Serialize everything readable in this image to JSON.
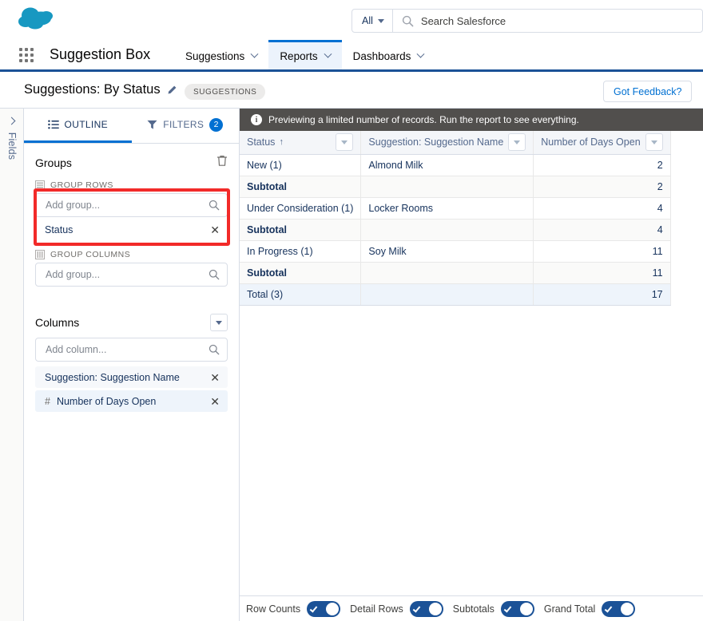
{
  "global_header": {
    "logo_icon": "salesforce-cloud-logo",
    "search": {
      "scope_label": "All",
      "placeholder": "Search Salesforce",
      "icon": "search-icon"
    }
  },
  "app_nav": {
    "launcher_icon": "app-launcher-waffle-icon",
    "app_name": "Suggestion Box",
    "tabs": [
      {
        "label": "Suggestions",
        "active": false,
        "icon": "chevron-down-icon"
      },
      {
        "label": "Reports",
        "active": true,
        "icon": "chevron-down-icon"
      },
      {
        "label": "Dashboards",
        "active": false,
        "icon": "chevron-down-icon"
      }
    ]
  },
  "page_header": {
    "title": "Suggestions: By Status",
    "edit_icon": "pencil-icon",
    "tag": "SUGGESTIONS",
    "feedback_button": "Got Feedback?"
  },
  "fields_rail": {
    "label": "Fields",
    "expand_icon": "chevron-right-icon"
  },
  "outline_panel": {
    "tabs": [
      {
        "label": "OUTLINE",
        "icon": "list-outline-icon",
        "active": true,
        "badge": null
      },
      {
        "label": "FILTERS",
        "icon": "filter-funnel-icon",
        "active": false,
        "badge": "2"
      }
    ],
    "groups": {
      "title": "Groups",
      "delete_icon": "trash-icon",
      "group_rows": {
        "heading": "GROUP ROWS",
        "icon": "group-rows-icon",
        "add_placeholder": "Add group...",
        "search_icon": "search-icon",
        "items": [
          {
            "label": "Status",
            "remove_icon": "close-icon"
          }
        ]
      },
      "group_columns": {
        "heading": "GROUP COLUMNS",
        "icon": "group-columns-icon",
        "add_placeholder": "Add group...",
        "search_icon": "search-icon",
        "items": []
      }
    },
    "columns": {
      "title": "Columns",
      "menu_icon": "chevron-down-icon",
      "add_placeholder": "Add column...",
      "search_icon": "search-icon",
      "items": [
        {
          "label": "Suggestion: Suggestion Name",
          "type_marker": "",
          "remove_icon": "close-icon"
        },
        {
          "label": "Number of Days Open",
          "type_marker": "#",
          "remove_icon": "close-icon"
        }
      ]
    }
  },
  "preview": {
    "notice": {
      "icon": "info-icon",
      "text": "Previewing a limited number of records. Run the report to see everything."
    },
    "columns": [
      {
        "label": "Status",
        "sort_icon": "sort-ascending-arrow",
        "menu_icon": "dropdown-triangle-icon",
        "align": "left"
      },
      {
        "label": "Suggestion: Suggestion Name",
        "sort_icon": "",
        "menu_icon": "dropdown-triangle-icon",
        "align": "left"
      },
      {
        "label": "Number of Days Open",
        "sort_icon": "",
        "menu_icon": "dropdown-triangle-icon",
        "align": "left"
      }
    ],
    "rows": [
      {
        "kind": "detail",
        "group": "New (1)",
        "name": "Almond Milk",
        "days": "2"
      },
      {
        "kind": "subtotal",
        "group": "Subtotal",
        "name": "",
        "days": "2"
      },
      {
        "kind": "detail",
        "group": "Under Consideration (1)",
        "name": "Locker Rooms",
        "days": "4"
      },
      {
        "kind": "subtotal",
        "group": "Subtotal",
        "name": "",
        "days": "4"
      },
      {
        "kind": "detail",
        "group": "In Progress (1)",
        "name": "Soy Milk",
        "days": "11"
      },
      {
        "kind": "subtotal",
        "group": "Subtotal",
        "name": "",
        "days": "11"
      },
      {
        "kind": "grand",
        "group": "Total (3)",
        "name": "",
        "days": "17"
      }
    ]
  },
  "footer": {
    "toggles": [
      {
        "label": "Row Counts",
        "on": true
      },
      {
        "label": "Detail Rows",
        "on": true
      },
      {
        "label": "Subtotals",
        "on": true
      },
      {
        "label": "Grand Total",
        "on": true
      }
    ]
  },
  "colors": {
    "brand_blue": "#0070d2",
    "nav_underline": "#1b5297",
    "highlight_red": "#f22a29",
    "notice_bar": "#514f4d",
    "grand_total_bg": "#eef4fb"
  }
}
